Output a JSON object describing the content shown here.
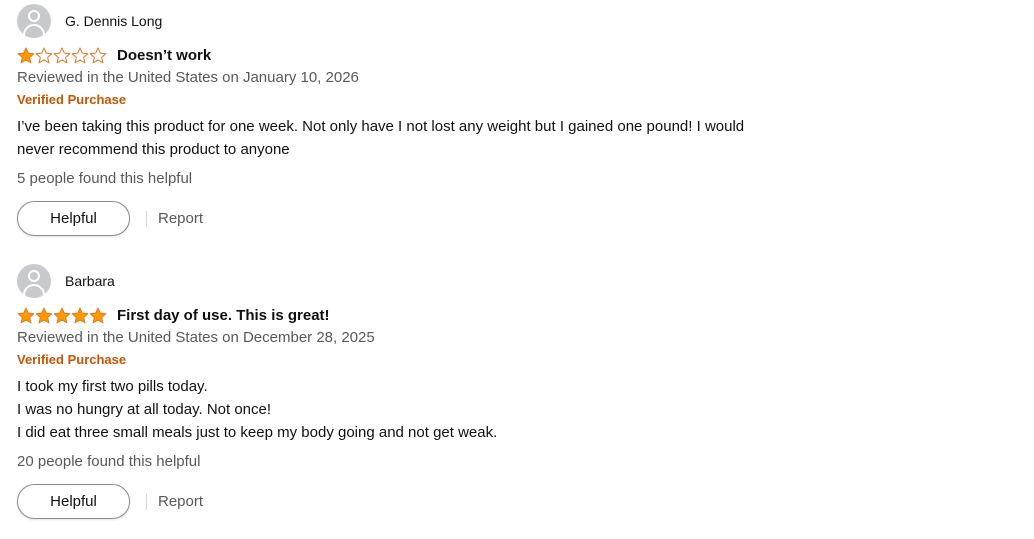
{
  "colors": {
    "star_fill": "#ff9900",
    "star_outline": "#de7921",
    "verified": "#c45500",
    "secondary_text": "#565959"
  },
  "reviews": [
    {
      "author": "G. Dennis Long",
      "rating": 1,
      "rating_max": 5,
      "title": "Doesn’t work",
      "meta": "Reviewed in the United States on January 10, 2026",
      "verified": "Verified Purchase",
      "body": [
        "I’ve been taking this product for one week. Not only have I not lost any weight but I gained one pound! I would never recommend this product to anyone"
      ],
      "helpful_count": "5 people found this helpful",
      "helpful_label": "Helpful",
      "report_label": "Report"
    },
    {
      "author": "Barbara",
      "rating": 5,
      "rating_max": 5,
      "title": "First day of use. This is great!",
      "meta": "Reviewed in the United States on December 28, 2025",
      "verified": "Verified Purchase",
      "body": [
        "I took my first two pills today.",
        "I was no hungry at all today. Not once!",
        "I did eat three small meals just to keep my body going and not get weak."
      ],
      "helpful_count": "20 people found this helpful",
      "helpful_label": "Helpful",
      "report_label": "Report"
    }
  ]
}
